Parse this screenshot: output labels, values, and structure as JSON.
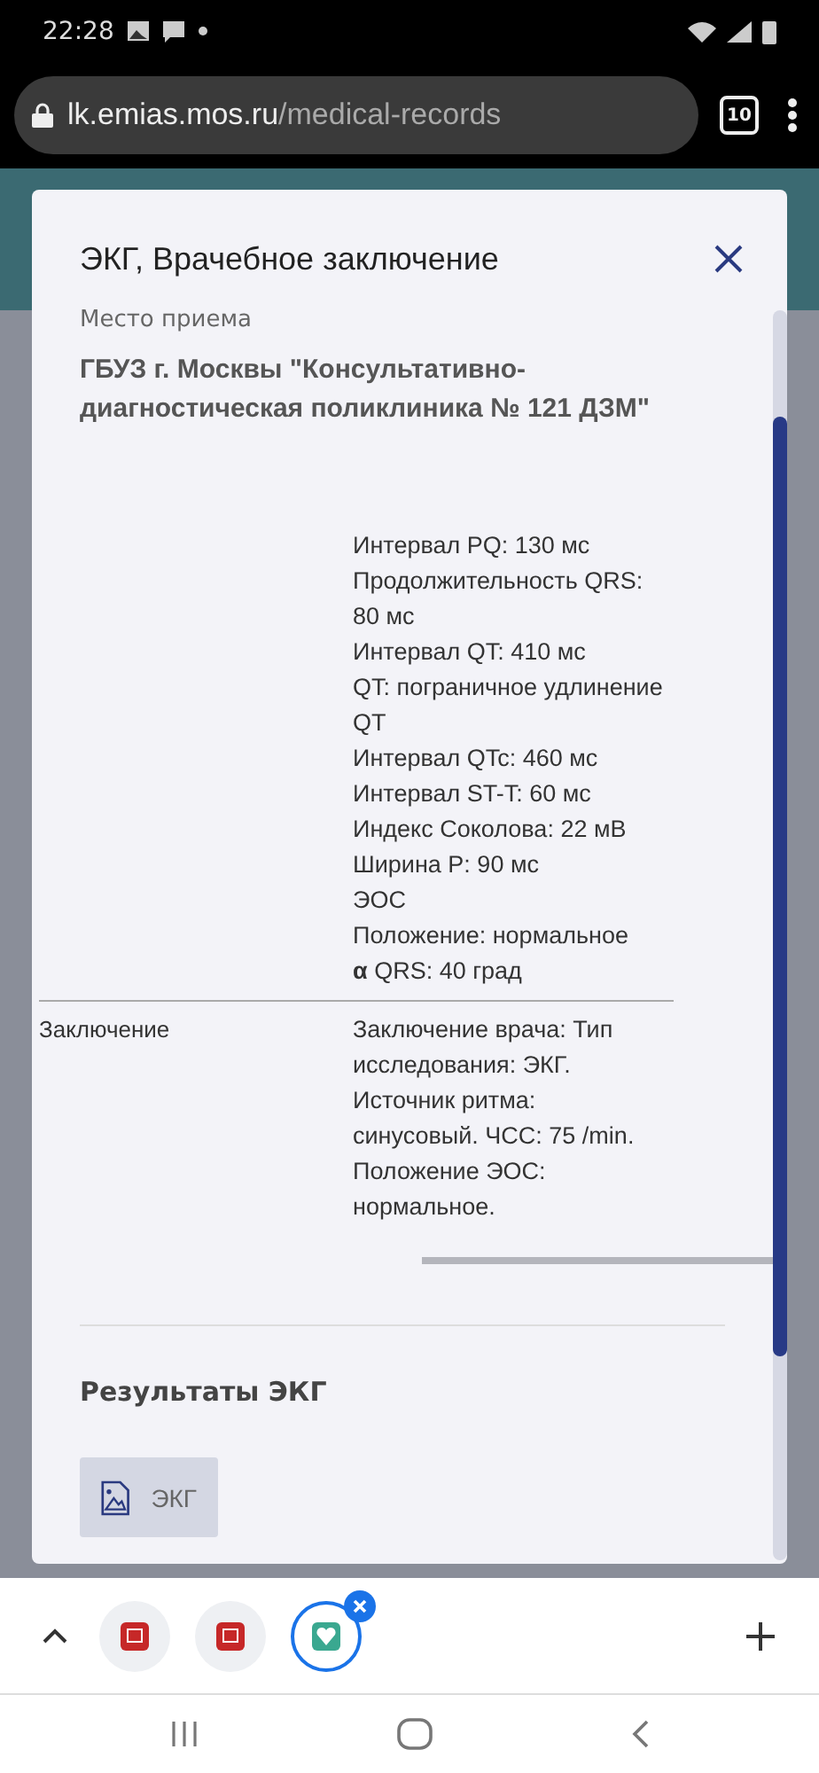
{
  "status_bar": {
    "time": "22:28"
  },
  "browser": {
    "url_host": "lk.emias.mos.ru",
    "url_path": "/medical-records",
    "tab_count": "10"
  },
  "modal": {
    "title": "ЭКГ, Врачебное заключение",
    "place_label": "Место приема",
    "place_value": "ГБУЗ г. Москвы \"Консультативно-диагностическая поликлиника № 121 ДЗМ\"",
    "rows": [
      {
        "label": "",
        "lines": [
          "Интервал PQ: 130 мс",
          "Продолжительность QRS: 80 мс",
          "Интервал QT: 410 мс",
          "QT: пограничное удлинение QT",
          "Интервал QTc: 460 мс",
          "Интервал ST-T: 60 мс",
          "Индекс Соколова: 22 мВ",
          "Ширина P: 90 мс",
          "ЭОС",
          "Положение: нормальное",
          "**α** QRS: 40 град"
        ]
      },
      {
        "label": "Заключение",
        "lines": [
          "Заключение врача: Тип исследования: ЭКГ.",
          "Источник ритма:",
          "синусовый. ЧСС: 75 /min.",
          "Положение ЭОС:",
          "нормальное."
        ]
      }
    ],
    "results_title": "Результаты ЭКГ",
    "attachments": [
      {
        "label": "ЭКГ"
      }
    ]
  },
  "tabs": [
    {
      "kind": "red",
      "selected": false
    },
    {
      "kind": "red",
      "selected": false
    },
    {
      "kind": "heart",
      "selected": true
    }
  ]
}
